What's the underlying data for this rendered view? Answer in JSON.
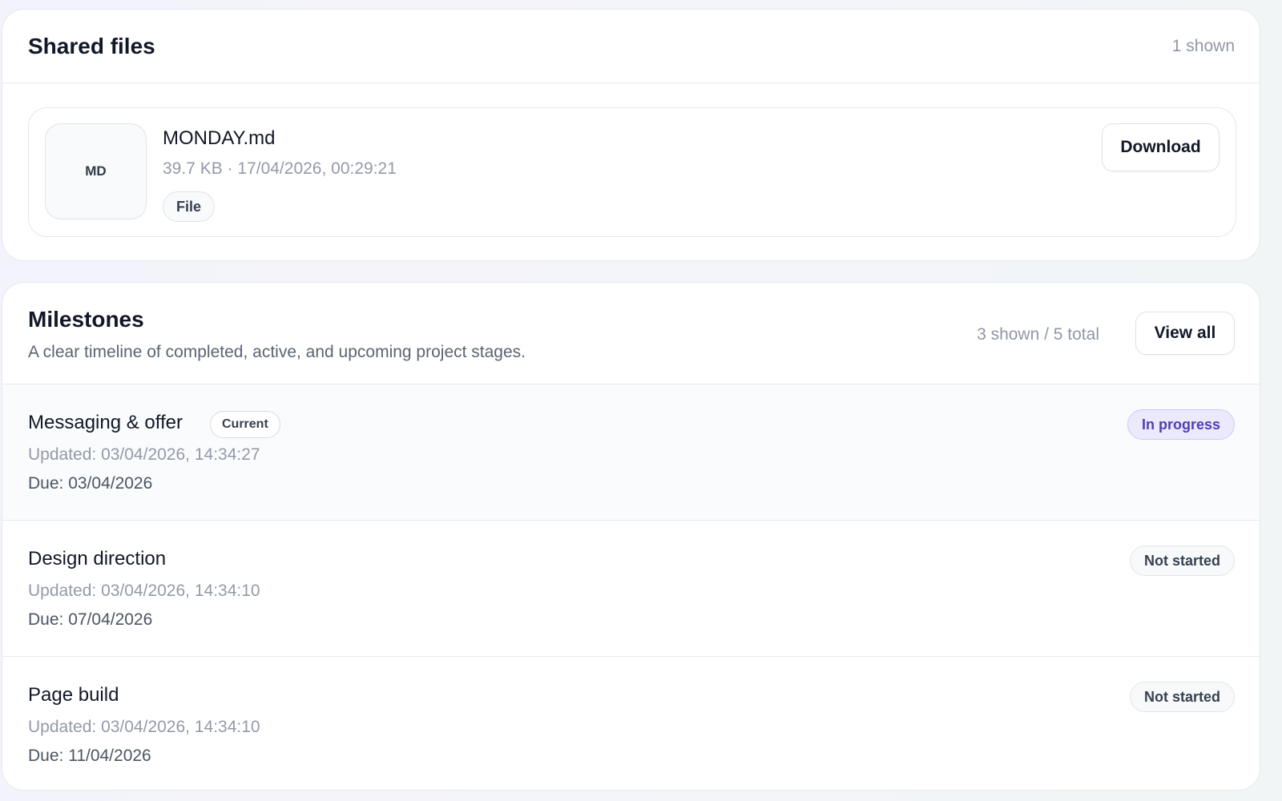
{
  "shared_files": {
    "title": "Shared files",
    "count": "1 shown",
    "files": [
      {
        "thumb_label": "MD",
        "name": "MONDAY.md",
        "meta": "39.7 KB · 17/04/2026, 00:29:21",
        "tag": "File",
        "download_label": "Download"
      }
    ]
  },
  "milestones": {
    "title": "Milestones",
    "subtitle": "A clear timeline of completed, active, and upcoming project stages.",
    "count": "3 shown / 5 total",
    "view_all_label": "View all",
    "items": [
      {
        "title": "Messaging & offer",
        "badge": "Current",
        "updated": "Updated: 03/04/2026, 14:34:27",
        "due": "Due: 03/04/2026",
        "status": "In progress"
      },
      {
        "title": "Design direction",
        "updated": "Updated: 03/04/2026, 14:34:10",
        "due": "Due: 07/04/2026",
        "status": "Not started"
      },
      {
        "title": "Page build",
        "updated": "Updated: 03/04/2026, 14:34:10",
        "due": "Due: 11/04/2026",
        "status": "Not started"
      }
    ]
  },
  "colors": {
    "in_progress_bg": "#ece9fd",
    "in_progress_text": "#4f3fb2",
    "not_started_bg": "#f8f9fa",
    "not_started_text": "#374151"
  }
}
